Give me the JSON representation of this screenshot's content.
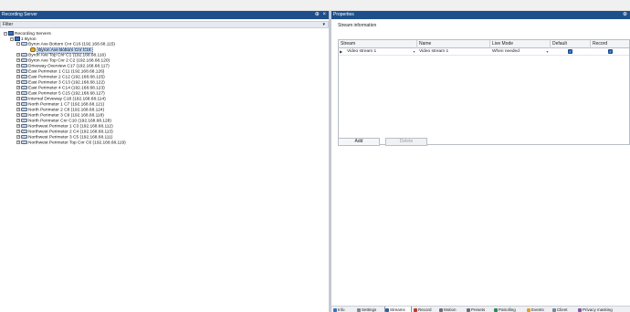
{
  "left_panel": {
    "title": "Recording Server",
    "pin_glyph": "⊕",
    "close_glyph": "×",
    "filter": {
      "label": "Filter",
      "arrow": "▾"
    }
  },
  "tree": {
    "root": "Recording Servers",
    "server": "1 Byron",
    "expanded_camera": "Byron Ave Bottom Cnr C16 (192.168.68.115)",
    "stream_node": "Byron Ave Bottom Cnr C16",
    "cameras": [
      "Byron Ave Top Cnr C1 (192.168.68.116)",
      "Byron Ave Top Cnr 2 C2 (192.168.68.120)",
      "Driveway Overview C17 (192.168.68.117)",
      "East Perimeter 1 C11 (192.168.68.126)",
      "East Perimeter 2 C12 (192.168.68.125)",
      "East Perimeter 3 C13 (192.168.68.122)",
      "East Perimeter 4 C14 (192.168.68.123)",
      "East Perimeter 5 C15 (192.168.68.127)",
      "Internal Driveway C18 (192.168.68.114)",
      "North Perimeter 1 C7 (192.168.68.121)",
      "North Perimeter 2 C8 (192.168.68.124)",
      "North Perimeter 3 C9 (192.168.68.118)",
      "North Perimeter Cnr C10 (192.168.68.128)",
      "Northwest Perimeter 1 C3 (192.168.68.112)",
      "Northwest Perimeter 2 C4 (192.168.68.113)",
      "Northwest Perimeter 3 C5 (192.168.68.111)",
      "Northwest Perimeter Top Cnr C6 (192.168.68.119)"
    ]
  },
  "right_panel": {
    "title": "Properties",
    "pin_glyph": "⊕",
    "section_title": "Stream information",
    "table": {
      "headers": [
        "Stream",
        "Name",
        "Live Mode",
        "Default",
        "Record"
      ],
      "rows": [
        {
          "marker": "▶",
          "stream": "Video stream 1",
          "name": "Video stream 1",
          "live_mode": "When needed",
          "default": "✓",
          "record": "✓"
        }
      ]
    },
    "buttons": {
      "add": "Add",
      "delete": "Delete"
    }
  },
  "tabs": [
    {
      "label": "Info",
      "color": "#3a6fc4",
      "active": false
    },
    {
      "label": "Settings",
      "color": "#7b8795",
      "active": false
    },
    {
      "label": "Streams",
      "color": "#2f5f9e",
      "active": true
    },
    {
      "label": "Record",
      "color": "#c0392b",
      "active": false
    },
    {
      "label": "Motion",
      "color": "#6a6f78",
      "active": false
    },
    {
      "label": "Presets",
      "color": "#6a6f78",
      "active": false
    },
    {
      "label": "Patrolling",
      "color": "#2c8a55",
      "active": false
    },
    {
      "label": "Events",
      "color": "#e0a020",
      "active": false
    },
    {
      "label": "Client",
      "color": "#7b8795",
      "active": false
    },
    {
      "label": "Privacy masking",
      "color": "#8a55a8",
      "active": false
    }
  ],
  "colors": {
    "pane_header": "#1e4f8a",
    "selection": "#c7d9f2",
    "checkbox": "#1f5fb5"
  }
}
